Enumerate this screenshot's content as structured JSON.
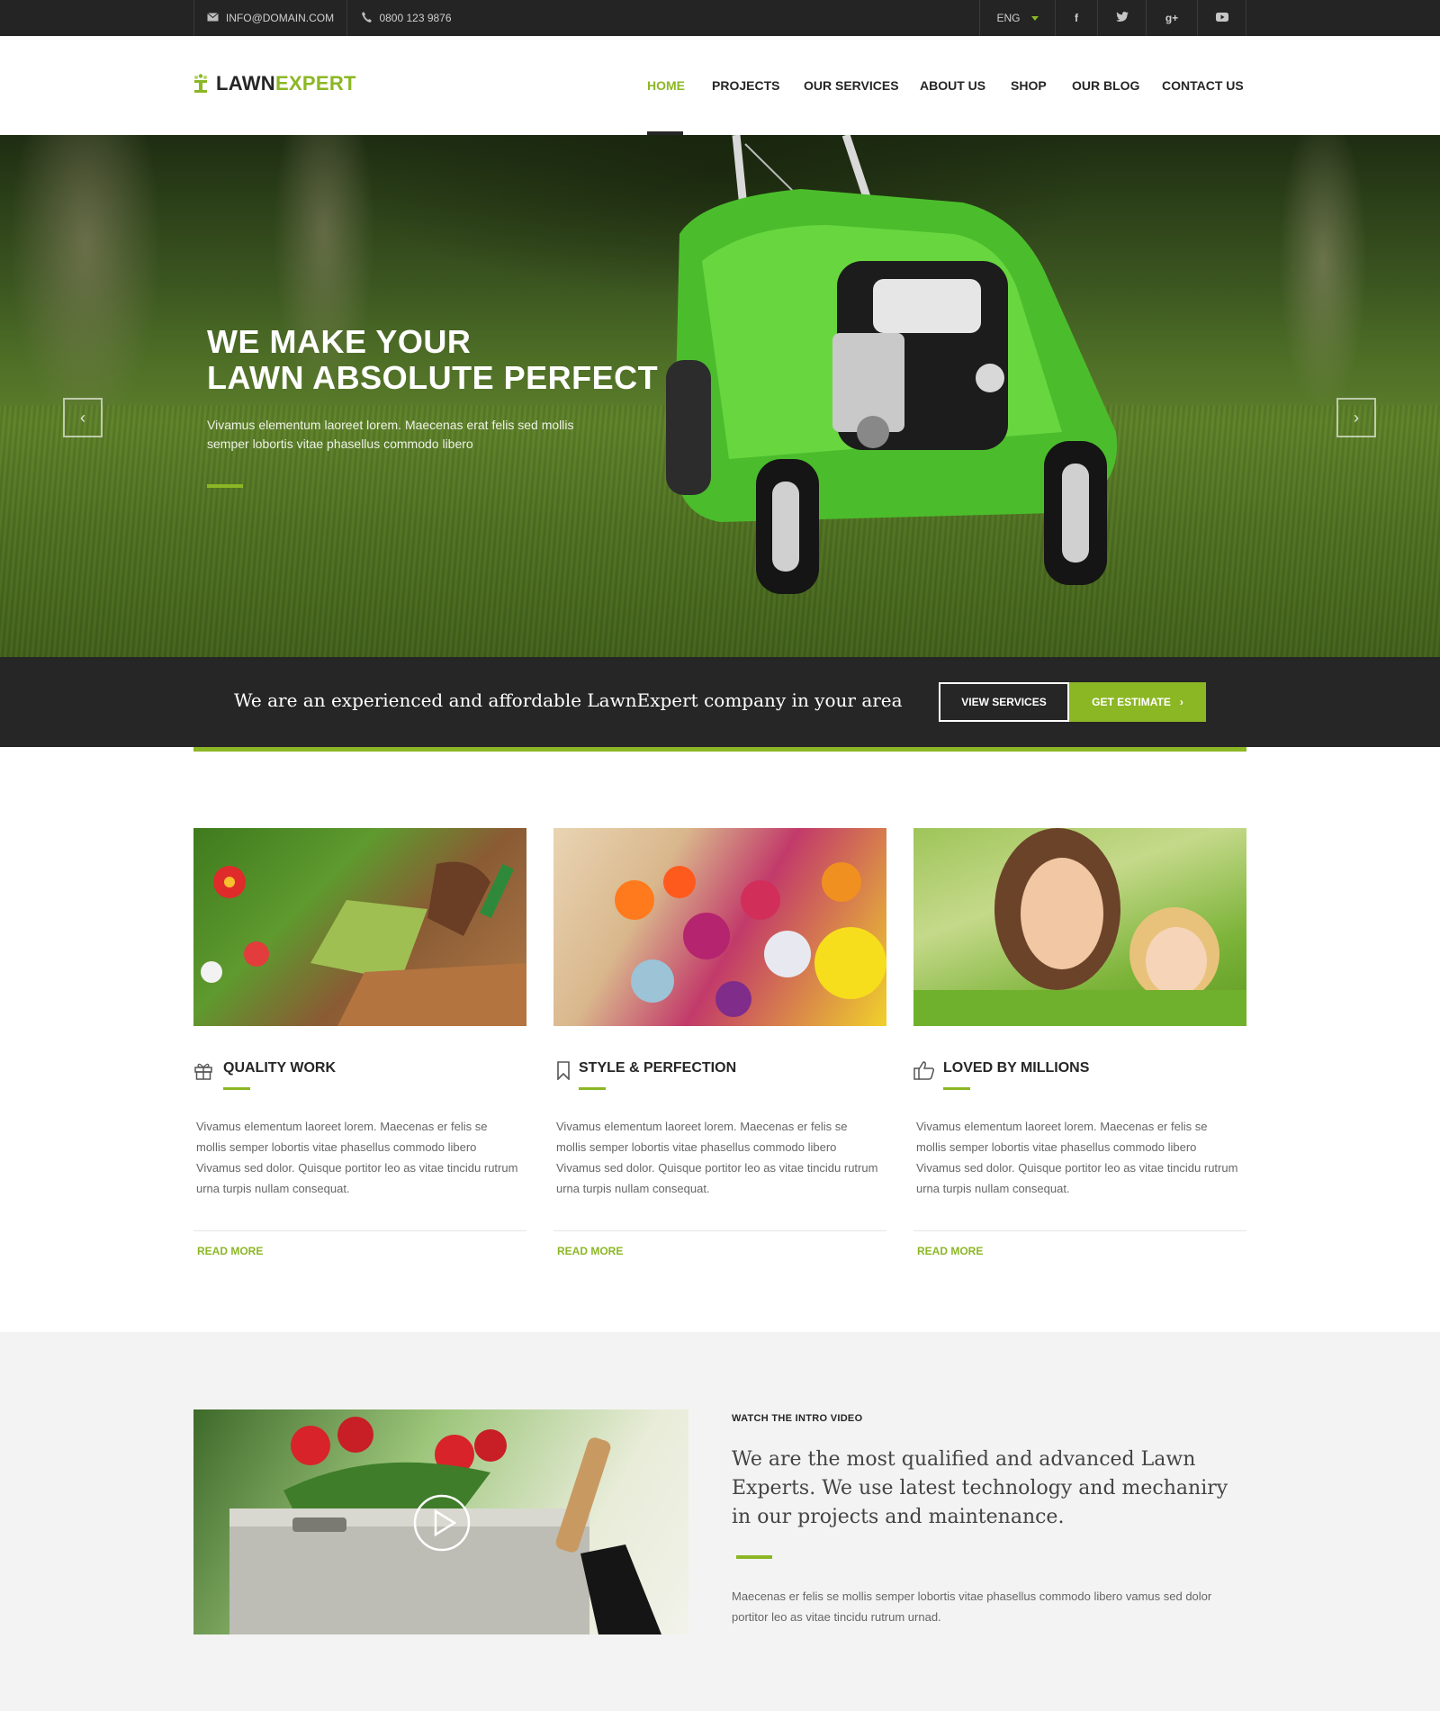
{
  "topbar": {
    "email": "INFO@DOMAIN.COM",
    "phone": "0800 123 9876",
    "language": "ENG",
    "social": [
      {
        "icon": "facebook-icon",
        "glyph": "f"
      },
      {
        "icon": "twitter-icon",
        "glyph": "t"
      },
      {
        "icon": "google-plus-icon",
        "glyph": "g+"
      },
      {
        "icon": "youtube-icon",
        "glyph": "▶"
      }
    ]
  },
  "brand": {
    "part1": "LAWN",
    "part2": "EXPERT",
    "accent": "#8cb725",
    "dark": "#262626"
  },
  "nav": {
    "items": [
      "HOME",
      "PROJECTS",
      "OUR SERVICES",
      "ABOUT US",
      "SHOP",
      "OUR BLOG",
      "CONTACT US"
    ],
    "active": "HOME"
  },
  "hero": {
    "title_line1": "WE MAKE YOUR",
    "title_line2": "LAWN ABSOLUTE PERFECT",
    "text": "Vivamus elementum laoreet lorem. Maecenas erat felis sed mollis semper lobortis vitae phasellus commodo libero",
    "prev_icon": "chevron-left-icon",
    "next_icon": "chevron-right-icon"
  },
  "promo": {
    "text": "We are an experienced and affordable LawnExpert company in your area",
    "view_services": "VIEW SERVICES",
    "get_estimate": "GET ESTIMATE"
  },
  "features": [
    {
      "icon": "gift-icon",
      "title": "QUALITY WORK",
      "text": "Vivamus elementum laoreet lorem. Maecenas er felis se mollis semper lobortis vitae phasellus commodo libero Vivamus sed dolor. Quisque portitor leo as vitae tincidu rutrum urna turpis nullam consequat.",
      "more": "READ MORE"
    },
    {
      "icon": "bookmark-icon",
      "title": "STYLE & PERFECTION",
      "text": "Vivamus elementum laoreet lorem. Maecenas er felis se mollis semper lobortis vitae phasellus commodo libero Vivamus sed dolor. Quisque portitor leo as vitae tincidu rutrum urna turpis nullam consequat.",
      "more": "READ MORE"
    },
    {
      "icon": "thumbs-up-icon",
      "title": "LOVED BY MILLIONS",
      "text": "Vivamus elementum laoreet lorem. Maecenas er felis se mollis semper lobortis vitae phasellus commodo libero Vivamus sed dolor. Quisque portitor leo as vitae tincidu rutrum urna turpis nullam consequat.",
      "more": "READ MORE"
    }
  ],
  "video": {
    "label": "WATCH THE INTRO VIDEO",
    "heading": "We are the most qualified and advanced Lawn Experts. We use latest technology and mechaniry in our projects and maintenance.",
    "text": "Maecenas er felis se mollis semper lobortis vitae phasellus commodo libero vamus sed dolor portitor leo as vitae tincidu rutrum urnad.",
    "play_icon": "play-icon"
  }
}
